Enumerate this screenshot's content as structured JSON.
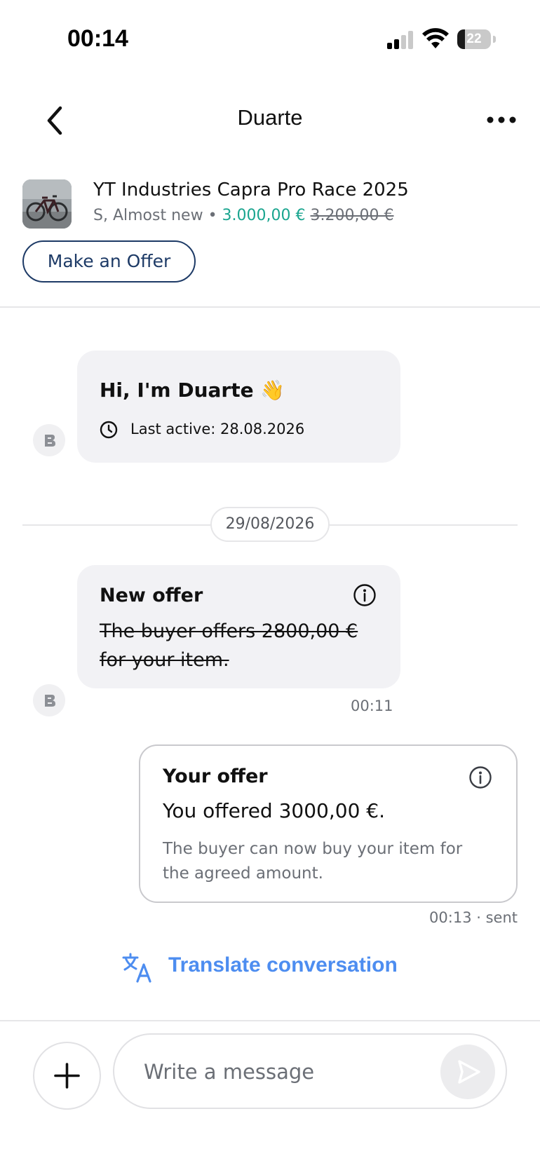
{
  "status_bar": {
    "time": "00:14",
    "battery_level": "22",
    "battery_fraction": 0.22
  },
  "nav": {
    "title": "Duarte",
    "back_icon": "chevron-left-icon",
    "more_icon": "more-horizontal-icon"
  },
  "listing": {
    "title": "YT Industries Capra Pro Race 2025",
    "size_condition": "S, Almost new",
    "separator": "•",
    "price": "3.000,00 €",
    "old_price": "3.200,00 €",
    "offer_button_label": "Make an Offer"
  },
  "messages": {
    "intro": {
      "title": "Hi, I'm Duarte 👋",
      "last_active": "Last active: 28.08.2026"
    },
    "date_separator": "29/08/2026",
    "incoming_offer": {
      "title": "New offer",
      "body": "The buyer offers 2800,00 € for your item.",
      "time": "00:11"
    },
    "my_offer": {
      "title": "Your offer",
      "body": "You offered 3000,00 €.",
      "note": "The buyer can now buy your item for the agreed amount.",
      "time_status": "00:13 · sent"
    }
  },
  "translate": {
    "label": "Translate conversation",
    "icon": "translate-icon"
  },
  "composer": {
    "placeholder": "Write a message",
    "add_icon": "plus-icon",
    "send_icon": "send-icon"
  },
  "colors": {
    "price_green": "#1aa58f",
    "offer_button_navy": "#1d3a66",
    "translate_blue": "#4d8df0",
    "bubble_gray": "#f2f2f5"
  }
}
